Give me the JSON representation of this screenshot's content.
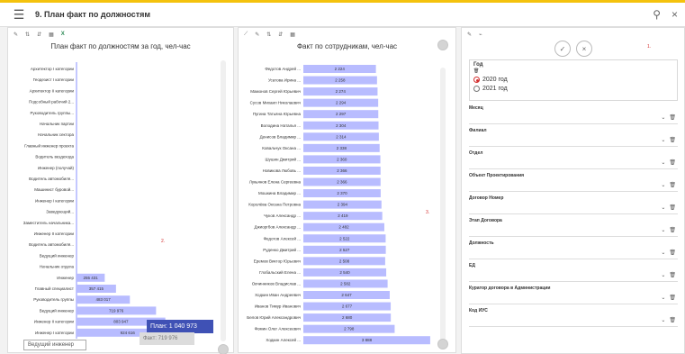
{
  "header": {
    "menu_icon": "menu-icon",
    "title": "9. План факт по должностям",
    "filter_icon": "filter-icon",
    "close_icon": "close-icon"
  },
  "left_panel": {
    "toolbar": [
      "edit-icon",
      "sort-icon",
      "sort-desc-icon",
      "table-icon",
      "x-icon"
    ],
    "title": "План факт по должностям за год, чел-час",
    "tooltip_plan": "План: 1 040 973",
    "tooltip_fact": "Факт: 719 976",
    "hover_label": "Ведущий инженер",
    "annotation": "2."
  },
  "center_panel": {
    "toolbar": [
      "line-icon",
      "edit-icon",
      "sort-icon",
      "sort-desc-icon",
      "table-icon"
    ],
    "title": "Факт по сотрудникам, чел-час",
    "annotation": "3."
  },
  "right_panel": {
    "toolbar": [
      "edit-icon",
      "link-icon"
    ],
    "confirm_icon": "check-icon",
    "cancel_icon": "close-icon",
    "annotation": "1.",
    "year": {
      "label": "Год",
      "options": [
        "2020 год",
        "2021 год"
      ],
      "selected": "2020 год"
    },
    "fields": [
      "Месяц",
      "Филиал",
      "Отдел",
      "Объект Проектирования",
      "Договор Номер",
      "Этап Договора",
      "Должность",
      "ЕД",
      "Куратор договора в Администрации",
      "Код ИУС"
    ]
  },
  "chart_data": [
    {
      "type": "bar",
      "title": "План факт по должностям за год, чел-час",
      "categories": [
        "Архитектор I категории",
        "Геодезист I категории",
        "Архитектор II категории",
        "Подсобный рабочий 2...",
        "Руководитель группы...",
        "Начальник партии",
        "Начальник сектора",
        "Главный инженер проекта",
        "Водитель вездехода",
        "Инженер (получай)",
        "Водитель автомобиля...",
        "Машинист буровой...",
        "Инженер I категории",
        "Заведующий...",
        "Заместитель начальника...",
        "Инженер II категории",
        "Водитель автомобиля...",
        "Ведущий инженер",
        "Начальник отдела",
        "Инженер",
        "Главный специалист",
        "Руководитель группы",
        "Ведущий инженер",
        "Инженер II категории",
        "Инженер I категории"
      ],
      "values": [
        0,
        0,
        0,
        0,
        0,
        0,
        0,
        0,
        0,
        0,
        0,
        0,
        0,
        0,
        0,
        0,
        0,
        0,
        0,
        255431,
        357415,
        483017,
        719976,
        803947,
        924616
      ]
    },
    {
      "type": "bar",
      "title": "Факт по сотрудникам, чел-час",
      "categories": [
        "Федотов Андрей ...",
        "Усатова Ирина ...",
        "Мамонов Сергей Юрьевич",
        "Сусов Михаил Николаевич",
        "Пугина Татьяна Юрьевна",
        "Володина Наталья ...",
        "Денисов Владимир ...",
        "Ковальчук Оксана ...",
        "Шушин Дмитрий ...",
        "Новикова Любовь ...",
        "Лукьянов Елена Сергеевна",
        "Мошкина Владимир ...",
        "Королёва Оксана Петровна",
        "Чуков Александр ...",
        "Джиоргбов Александр ...",
        "Федотов Алексей ...",
        "Руденко Дмитрий ...",
        "Еремов Виктор Юрьевич",
        "Глобальский Елена ...",
        "Овчинников Владислав ...",
        "Ходкин Иван Андреевич",
        "Иванов Тимур Иванович",
        "Белов Юрий Александрович",
        "Фомин Олег Алексеевич",
        "Ходкин Алексей ..."
      ],
      "values": [
        2224,
        2258,
        2274,
        2294,
        2297,
        2304,
        2314,
        2338,
        2360,
        2366,
        2366,
        2370,
        2394,
        2419,
        2482,
        2522,
        2527,
        2508,
        2540,
        2582,
        2647,
        2677,
        2680,
        2798,
        3888
      ]
    }
  ]
}
